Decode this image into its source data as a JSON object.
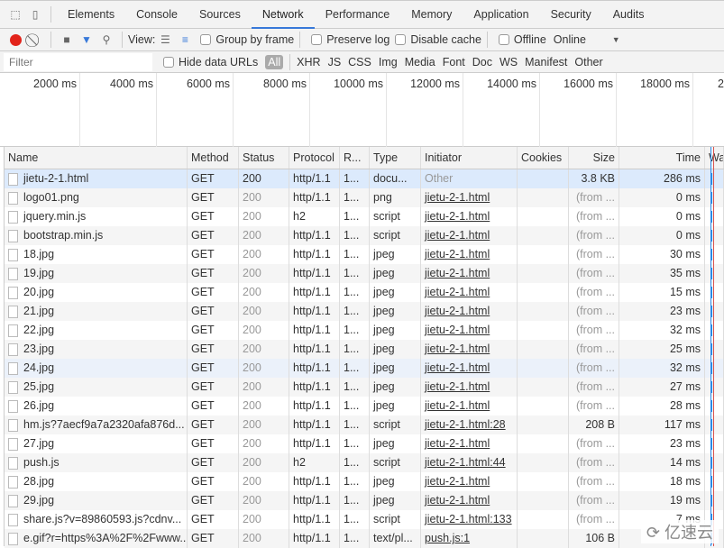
{
  "tabs": [
    "Elements",
    "Console",
    "Sources",
    "Network",
    "Performance",
    "Memory",
    "Application",
    "Security",
    "Audits"
  ],
  "active_tab": "Network",
  "toolbar": {
    "view_label": "View:",
    "group_by_frame": "Group by frame",
    "preserve_log": "Preserve log",
    "disable_cache": "Disable cache",
    "offline": "Offline",
    "throttle": "Online"
  },
  "filter": {
    "placeholder": "Filter",
    "hide_data_urls": "Hide data URLs",
    "types": [
      "All",
      "XHR",
      "JS",
      "CSS",
      "Img",
      "Media",
      "Font",
      "Doc",
      "WS",
      "Manifest",
      "Other"
    ]
  },
  "overview_ticks": [
    "2000 ms",
    "4000 ms",
    "6000 ms",
    "8000 ms",
    "10000 ms",
    "12000 ms",
    "14000 ms",
    "16000 ms",
    "18000 ms",
    "2"
  ],
  "columns": [
    "Name",
    "Method",
    "Status",
    "Protocol",
    "R...",
    "Type",
    "Initiator",
    "Cookies",
    "Size",
    "Time",
    "Wat"
  ],
  "rows": [
    [
      "jietu-2-1.html",
      "GET",
      "200",
      "http/1.1",
      "1...",
      "docu...",
      "Other",
      "",
      "3.8 KB",
      "286 ms"
    ],
    [
      "logo01.png",
      "GET",
      "200",
      "http/1.1",
      "1...",
      "png",
      "jietu-2-1.html",
      "",
      "(from ...",
      "0 ms"
    ],
    [
      "jquery.min.js",
      "GET",
      "200",
      "h2",
      "1...",
      "script",
      "jietu-2-1.html",
      "",
      "(from ...",
      "0 ms"
    ],
    [
      "bootstrap.min.js",
      "GET",
      "200",
      "http/1.1",
      "1...",
      "script",
      "jietu-2-1.html",
      "",
      "(from ...",
      "0 ms"
    ],
    [
      "18.jpg",
      "GET",
      "200",
      "http/1.1",
      "1...",
      "jpeg",
      "jietu-2-1.html",
      "",
      "(from ...",
      "30 ms"
    ],
    [
      "19.jpg",
      "GET",
      "200",
      "http/1.1",
      "1...",
      "jpeg",
      "jietu-2-1.html",
      "",
      "(from ...",
      "35 ms"
    ],
    [
      "20.jpg",
      "GET",
      "200",
      "http/1.1",
      "1...",
      "jpeg",
      "jietu-2-1.html",
      "",
      "(from ...",
      "15 ms"
    ],
    [
      "21.jpg",
      "GET",
      "200",
      "http/1.1",
      "1...",
      "jpeg",
      "jietu-2-1.html",
      "",
      "(from ...",
      "23 ms"
    ],
    [
      "22.jpg",
      "GET",
      "200",
      "http/1.1",
      "1...",
      "jpeg",
      "jietu-2-1.html",
      "",
      "(from ...",
      "32 ms"
    ],
    [
      "23.jpg",
      "GET",
      "200",
      "http/1.1",
      "1...",
      "jpeg",
      "jietu-2-1.html",
      "",
      "(from ...",
      "25 ms"
    ],
    [
      "24.jpg",
      "GET",
      "200",
      "http/1.1",
      "1...",
      "jpeg",
      "jietu-2-1.html",
      "",
      "(from ...",
      "32 ms"
    ],
    [
      "25.jpg",
      "GET",
      "200",
      "http/1.1",
      "1...",
      "jpeg",
      "jietu-2-1.html",
      "",
      "(from ...",
      "27 ms"
    ],
    [
      "26.jpg",
      "GET",
      "200",
      "http/1.1",
      "1...",
      "jpeg",
      "jietu-2-1.html",
      "",
      "(from ...",
      "28 ms"
    ],
    [
      "hm.js?7aecf9a7a2320afa876d...",
      "GET",
      "200",
      "http/1.1",
      "1...",
      "script",
      "jietu-2-1.html:28",
      "",
      "208 B",
      "117 ms"
    ],
    [
      "27.jpg",
      "GET",
      "200",
      "http/1.1",
      "1...",
      "jpeg",
      "jietu-2-1.html",
      "",
      "(from ...",
      "23 ms"
    ],
    [
      "push.js",
      "GET",
      "200",
      "h2",
      "1...",
      "script",
      "jietu-2-1.html:44",
      "",
      "(from ...",
      "14 ms"
    ],
    [
      "28.jpg",
      "GET",
      "200",
      "http/1.1",
      "1...",
      "jpeg",
      "jietu-2-1.html",
      "",
      "(from ...",
      "18 ms"
    ],
    [
      "29.jpg",
      "GET",
      "200",
      "http/1.1",
      "1...",
      "jpeg",
      "jietu-2-1.html",
      "",
      "(from ...",
      "19 ms"
    ],
    [
      "share.js?v=89860593.js?cdnv...",
      "GET",
      "200",
      "http/1.1",
      "1...",
      "script",
      "jietu-2-1.html:133",
      "",
      "(from ...",
      "7 ms"
    ],
    [
      "e.gif?r=https%3A%2F%2Fwww...",
      "GET",
      "200",
      "http/1.1",
      "1...",
      "text/pl...",
      "push.js:1",
      "",
      "106 B",
      ""
    ]
  ],
  "selected_row": 0,
  "hover_row": 10,
  "watermark": "亿速云",
  "colors": {
    "accent": "#3879d9",
    "record": "#e2231a",
    "selected": "#dceafc"
  }
}
